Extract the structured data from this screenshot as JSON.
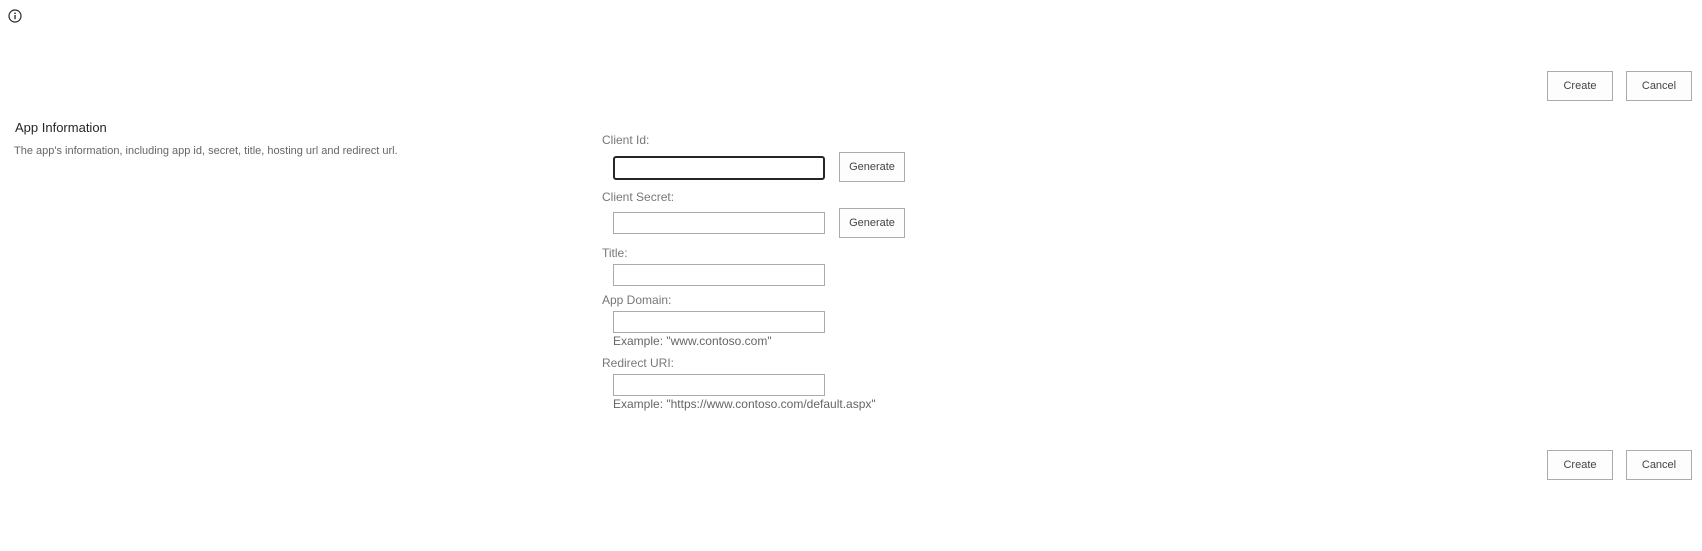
{
  "top_actions": {
    "create_label": "Create",
    "cancel_label": "Cancel"
  },
  "bottom_actions": {
    "create_label": "Create",
    "cancel_label": "Cancel"
  },
  "section": {
    "title": "App Information",
    "description": "The app's information, including app id, secret, title, hosting url and redirect url."
  },
  "fields": {
    "client_id": {
      "label": "Client Id:",
      "value": "",
      "generate_label": "Generate"
    },
    "client_secret": {
      "label": "Client Secret:",
      "value": "",
      "generate_label": "Generate"
    },
    "title": {
      "label": "Title:",
      "value": ""
    },
    "app_domain": {
      "label": "App Domain:",
      "value": "",
      "example": "Example: \"www.contoso.com\""
    },
    "redirect_uri": {
      "label": "Redirect URI:",
      "value": "",
      "example": "Example: \"https://www.contoso.com/default.aspx\""
    }
  },
  "icons": {
    "info": "info-icon"
  }
}
